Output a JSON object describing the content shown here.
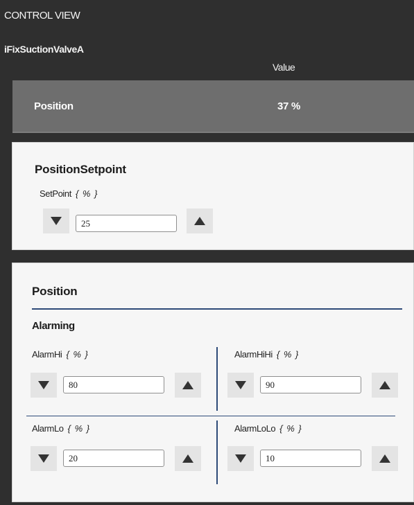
{
  "header": {
    "title": "CONTROL VIEW",
    "tag_name": "iFixSuctionValveA",
    "column_label": "Value"
  },
  "position_row": {
    "label": "Position",
    "value": "37 %"
  },
  "setpoint_card": {
    "title": "PositionSetpoint",
    "field_label": "SetPoint",
    "unit": "{ % }",
    "value": "25"
  },
  "alarm_card": {
    "title": "Position",
    "section_label": "Alarming",
    "fields": [
      {
        "label": "AlarmHi",
        "unit": "{ % }",
        "value": "80"
      },
      {
        "label": "AlarmHiHi",
        "unit": "{ % }",
        "value": "90"
      },
      {
        "label": "AlarmLo",
        "unit": "{ % }",
        "value": "20"
      },
      {
        "label": "AlarmLoLo",
        "unit": "{ % }",
        "value": "10"
      }
    ]
  },
  "colors": {
    "background": "#2f2f2f",
    "row_band": "#6e6e6e",
    "card": "#f6f6f6",
    "divider": "#2d4a78",
    "button": "#e4e4e4",
    "arrow": "#333333"
  },
  "icons": {
    "decrement": "triangle-down-icon",
    "increment": "triangle-up-icon"
  }
}
